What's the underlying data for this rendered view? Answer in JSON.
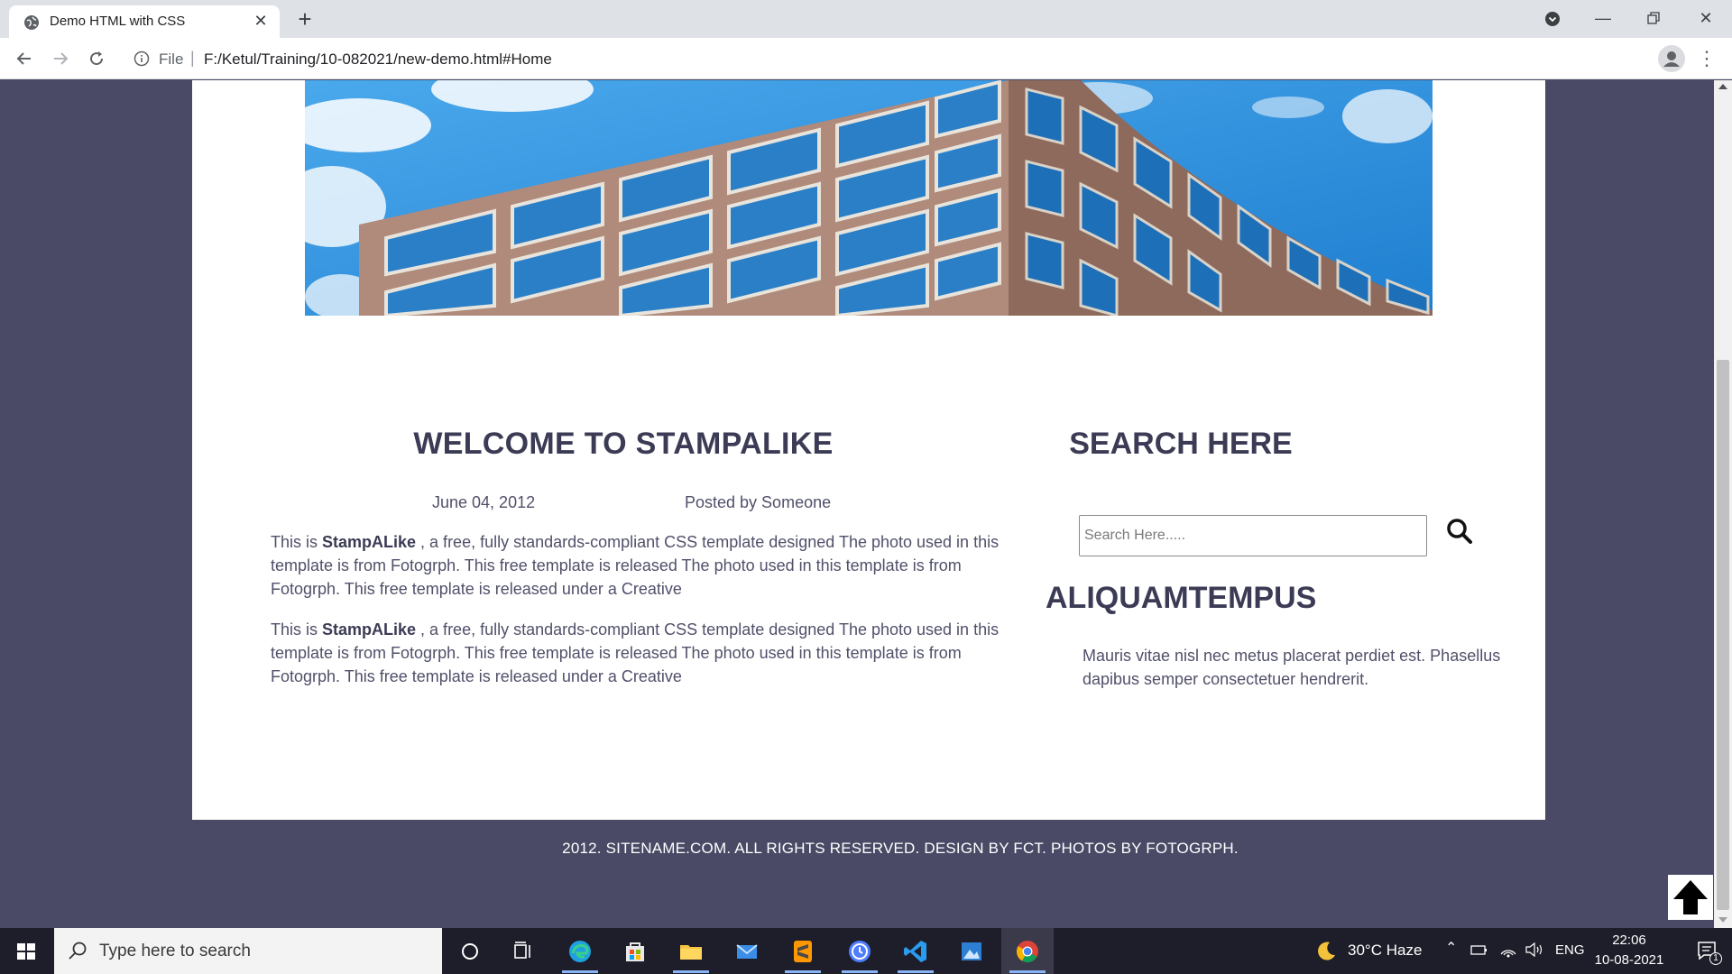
{
  "browser": {
    "tab_title": "Demo HTML with CSS",
    "url_scheme": "File",
    "url": "F:/Ketul/Training/10-082021/new-demo.html#Home"
  },
  "main": {
    "heading": "WELCOME TO STAMPALIKE",
    "date": "June 04, 2012",
    "posted_by": "Posted by Someone",
    "brand": "StampALike",
    "para1_text": " , a free, fully standards-compliant CSS template designed The photo used in this template is from Fotogrph. This free template is released The photo used in this template is from Fotogrph. This free template is released under a Creative",
    "para2_text": " , a free, fully standards-compliant CSS template designed The photo used in this template is from Fotogrph. This free template is released The photo used in this template is from Fotogrph. This free template is released under a Creative",
    "para_prefix": "This is "
  },
  "sidebar": {
    "search_heading": "SEARCH HERE",
    "search_placeholder": "Search Here.....",
    "section_heading": "ALIQUAMTEMPUS",
    "section_text": "Mauris vitae nisl nec metus placerat perdiet est. Phasellus dapibus semper consectetuer hendrerit."
  },
  "footer": {
    "text": "2012. SITENAME.COM. ALL RIGHTS RESERVED. DESIGN BY FCT. PHOTOS BY FOTOGRPH."
  },
  "taskbar": {
    "search_placeholder": "Type here to search",
    "weather": "30°C  Haze",
    "language": "ENG",
    "time": "22:06",
    "date": "10-08-2021",
    "notification_count": "1"
  },
  "colors": {
    "page_background": "#4a4a66",
    "heading_text": "#3b3b55",
    "body_text": "#50506a",
    "sky_blue": "#2b8fd9"
  }
}
